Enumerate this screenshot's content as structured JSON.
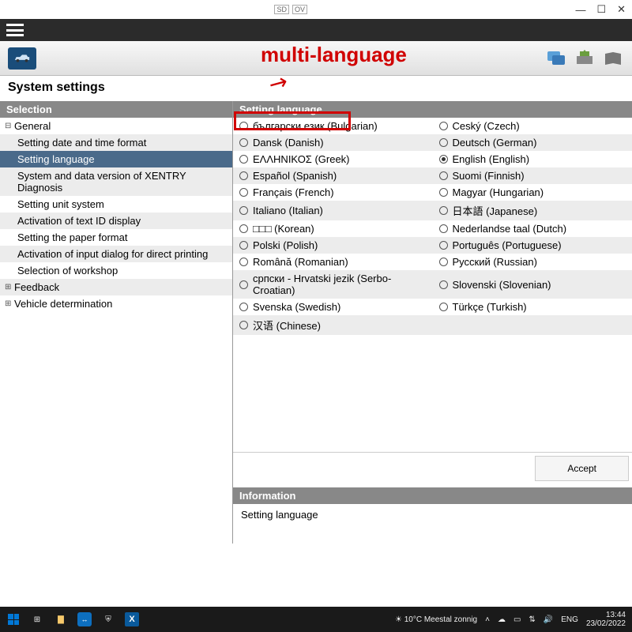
{
  "titlebar": {
    "center1": "SD",
    "center2": "OV"
  },
  "page_title": "System settings",
  "sidebar": {
    "header": "Selection",
    "groups": [
      {
        "label": "General",
        "expanded": true,
        "children": [
          "Setting date and time format",
          "Setting language",
          "System and data version of XENTRY Diagnosis",
          "Setting unit system",
          "Activation of text ID display",
          "Setting the paper format",
          "Activation of input dialog for direct printing",
          "Selection of workshop"
        ],
        "selected_index": 1
      },
      {
        "label": "Feedback",
        "expanded": false
      },
      {
        "label": "Vehicle determination",
        "expanded": false
      }
    ]
  },
  "main": {
    "header": "Setting language",
    "languages": [
      [
        "български език (Bulgarian)",
        "Ceský (Czech)"
      ],
      [
        "Dansk (Danish)",
        "Deutsch (German)"
      ],
      [
        "ΕΛΛΗΝΙΚΟΣ (Greek)",
        "English (English)"
      ],
      [
        "Español (Spanish)",
        "Suomi (Finnish)"
      ],
      [
        "Français (French)",
        "Magyar (Hungarian)"
      ],
      [
        "Italiano (Italian)",
        "日本語 (Japanese)"
      ],
      [
        "□□□ (Korean)",
        "Nederlandse taal (Dutch)"
      ],
      [
        "Polski (Polish)",
        "Português (Portuguese)"
      ],
      [
        "Română (Romanian)",
        "Русский (Russian)"
      ],
      [
        "српски - Hrvatski jezik (Serbo-Croatian)",
        "Slovenski (Slovenian)"
      ],
      [
        "Svenska (Swedish)",
        "Türkçe (Turkish)"
      ],
      [
        "汉语 (Chinese)",
        ""
      ]
    ],
    "selected": "English (English)",
    "accept": "Accept",
    "info_header": "Information",
    "info_body": "Setting language"
  },
  "annotation": {
    "label": "multi-language"
  },
  "taskbar": {
    "weather": "10°C  Meestal zonnig",
    "lang": "ENG",
    "time": "13:44",
    "date": "23/02/2022"
  }
}
